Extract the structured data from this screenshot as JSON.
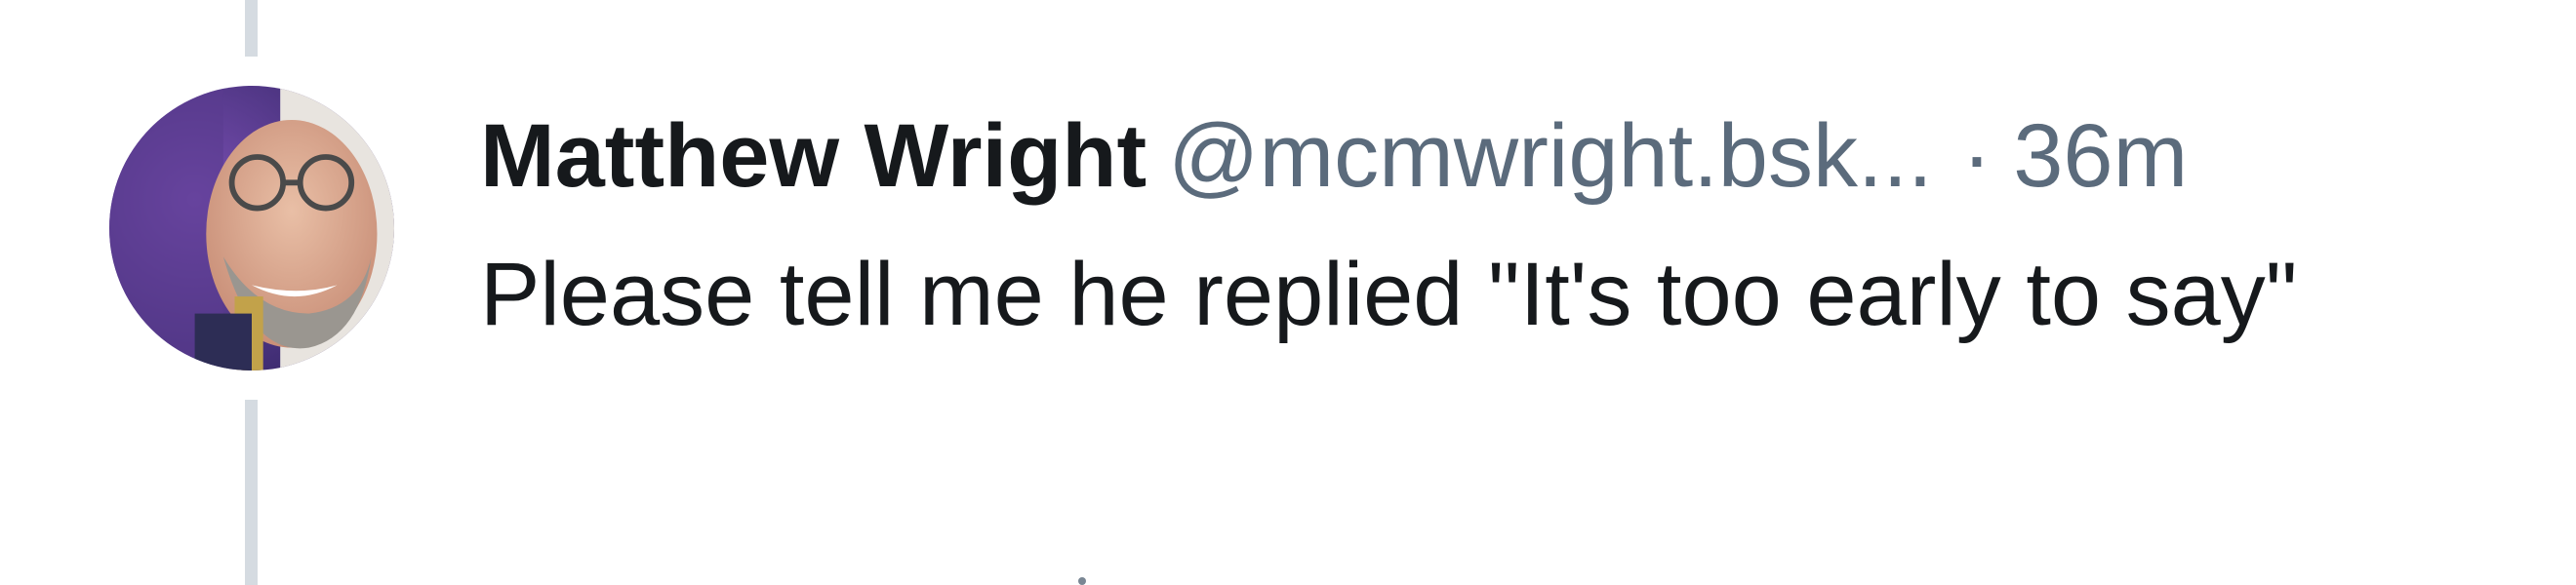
{
  "post": {
    "author": {
      "display_name": "Matthew Wright",
      "handle": "@mcmwright.bsk...",
      "avatar": "avatar-photo"
    },
    "separator": "·",
    "timestamp": "36m",
    "text": "Please tell me he replied \"It's too early to say\""
  },
  "colors": {
    "thread_line": "#d5dbe1",
    "text_primary": "#16191c",
    "text_secondary": "#5b6b7c",
    "background": "#ffffff"
  }
}
